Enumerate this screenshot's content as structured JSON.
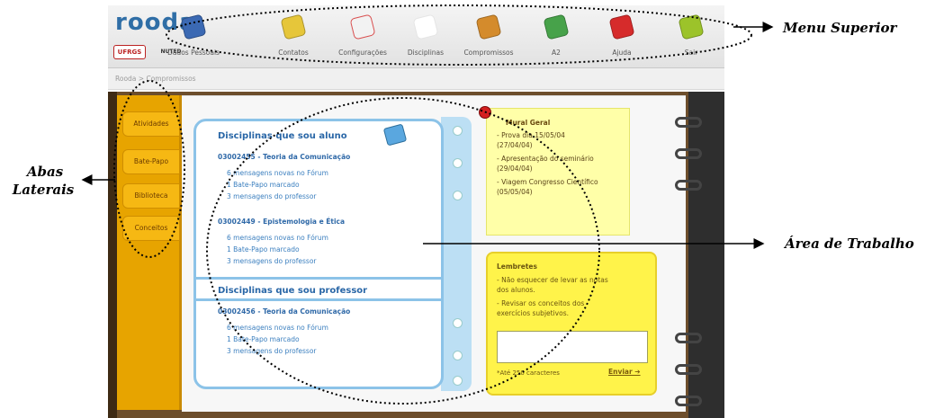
{
  "app": {
    "logo": "rooda",
    "institution": "UFRGS",
    "partner": "NUTED"
  },
  "menu": [
    {
      "label": "Dados Pessoais",
      "icon": "personal-data-icon",
      "color": "#3b69b3"
    },
    {
      "label": "Contatos",
      "icon": "contacts-icon",
      "color": "#e6c63a"
    },
    {
      "label": "Configurações",
      "icon": "settings-icon",
      "color": "#d94f4f"
    },
    {
      "label": "Disciplinas",
      "icon": "disciplines-icon",
      "color": "#ffffff"
    },
    {
      "label": "Compromissos",
      "icon": "commitments-icon",
      "color": "#d48b2c"
    },
    {
      "label": "A2",
      "icon": "a2-icon",
      "color": "#47a24a"
    },
    {
      "label": "Ajuda",
      "icon": "help-icon",
      "color": "#d62b2b"
    },
    {
      "label": "Sair",
      "icon": "exit-icon",
      "color": "#9cc32a"
    }
  ],
  "breadcrumb": "Rooda > Compromissos",
  "tabs": [
    "Atividades",
    "Bate-Papo",
    "Biblioteca",
    "Conceitos"
  ],
  "student": {
    "heading": "Disciplinas que sou aluno",
    "courses": [
      {
        "title": "03002455 - Teoria da Comunicação",
        "lines": [
          "6 mensagens novas no Fórum",
          "1 Bate-Papo marcado",
          "3 mensagens do professor"
        ]
      },
      {
        "title": "03002449 - Epistemologia e Ética",
        "lines": [
          "6 mensagens novas no Fórum",
          "1 Bate-Papo marcado",
          "3 mensagens do professor"
        ]
      }
    ]
  },
  "teacher": {
    "heading": "Disciplinas que sou professor",
    "courses": [
      {
        "title": "03002456 - Teoria da Comunicação",
        "lines": [
          "6 mensagens novas no Fórum",
          "1 Bate-Papo marcado",
          "3 mensagens do professor"
        ]
      }
    ]
  },
  "mural": {
    "title": "Mural Geral",
    "items": [
      "- Prova dia 15/05/04",
      "  (27/04/04)",
      "- Apresentação do seminário",
      "  (29/04/04)",
      "- Viagem Congresso Científico",
      "  (05/05/04)"
    ]
  },
  "lembretes": {
    "title": "Lembretes",
    "items": [
      "- Não esquecer de levar as notas",
      "  dos alunos.",
      "- Revisar os conceitos dos",
      "  exercícios subjetivos."
    ],
    "note": "*Até 250 caracteres",
    "send": "Enviar ➔"
  },
  "annotations": {
    "top": "Menu Superior",
    "left_line1": "Abas",
    "left_line2": "Laterais",
    "work": "Área de Trabalho"
  },
  "colors": {
    "tab_orange": "#f6b813",
    "card_blue": "#8cc3e8",
    "mural_yellow": "#ffffa8",
    "lembretes_yellow": "#fff34a"
  }
}
